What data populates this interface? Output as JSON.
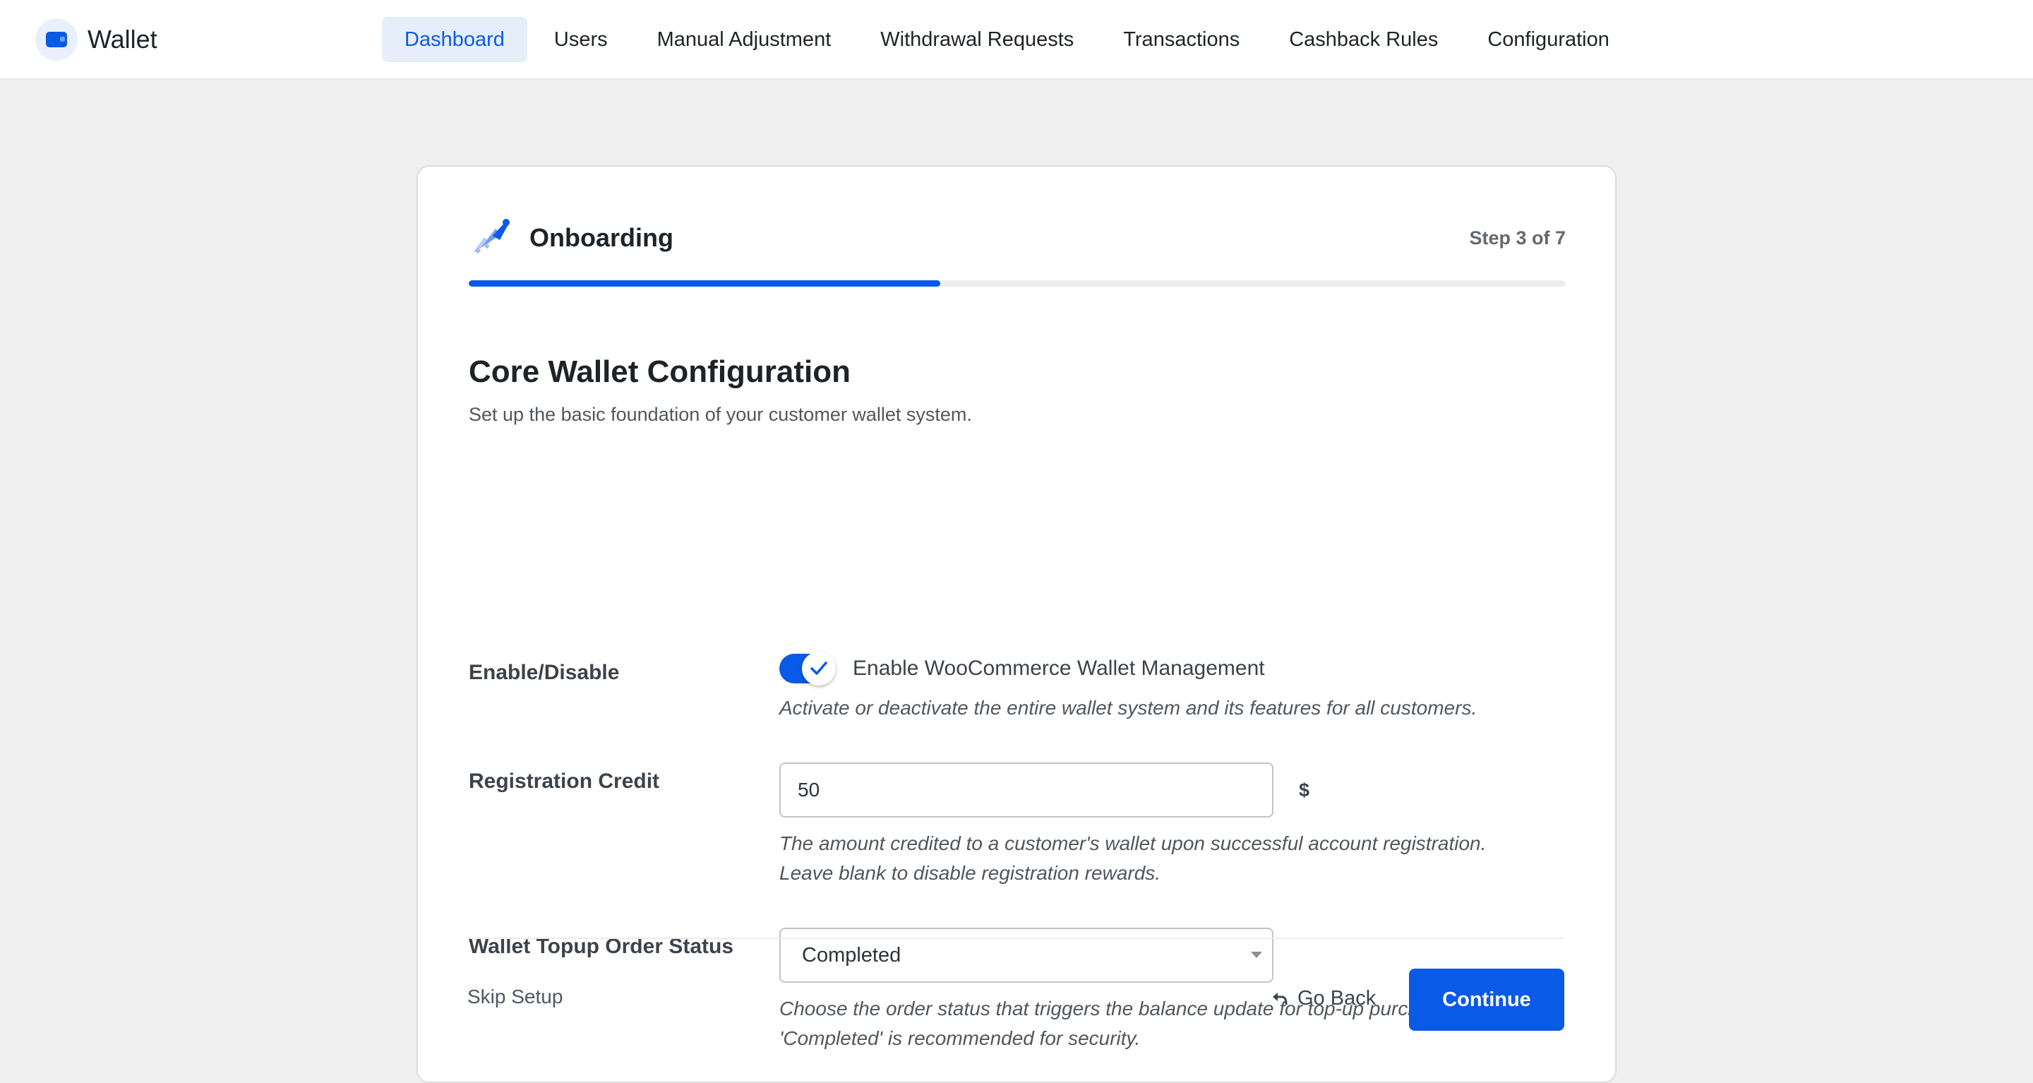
{
  "brand": {
    "title": "Wallet",
    "icon": "wallet-icon"
  },
  "nav": [
    {
      "label": "Dashboard",
      "active": true
    },
    {
      "label": "Users",
      "active": false
    },
    {
      "label": "Manual Adjustment",
      "active": false
    },
    {
      "label": "Withdrawal Requests",
      "active": false
    },
    {
      "label": "Transactions",
      "active": false
    },
    {
      "label": "Cashback Rules",
      "active": false
    },
    {
      "label": "Configuration",
      "active": false
    }
  ],
  "onboarding": {
    "icon": "rocket-icon",
    "title": "Onboarding",
    "step_text": "Step 3 of 7",
    "progress": 0.43
  },
  "section": {
    "title": "Core Wallet Configuration",
    "description": "Set up the basic foundation of your customer wallet system."
  },
  "fields": {
    "enable": {
      "label": "Enable/Disable",
      "toggle_label": "Enable WooCommerce Wallet Management",
      "checked": true,
      "help": "Activate or deactivate the entire wallet system and its features for all customers."
    },
    "registration_credit": {
      "label": "Registration Credit",
      "value": "50",
      "unit": "$",
      "help_line1": "The amount credited to a customer's wallet upon successful account registration.",
      "help_line2": "Leave blank to disable registration rewards."
    },
    "topup_status": {
      "label": "Wallet Topup Order Status",
      "selected": "Completed",
      "help_line1": "Choose the order status that triggers the balance update for top-up purchases.",
      "help_line2": "'Completed' is recommended for security."
    }
  },
  "footer": {
    "skip_label": "Skip Setup",
    "back_label": "Go Back",
    "continue_label": "Continue"
  },
  "colors": {
    "accent": "#0a5ae8",
    "page_bg": "#f0f0f1",
    "active_nav_bg": "#e6eef9"
  }
}
